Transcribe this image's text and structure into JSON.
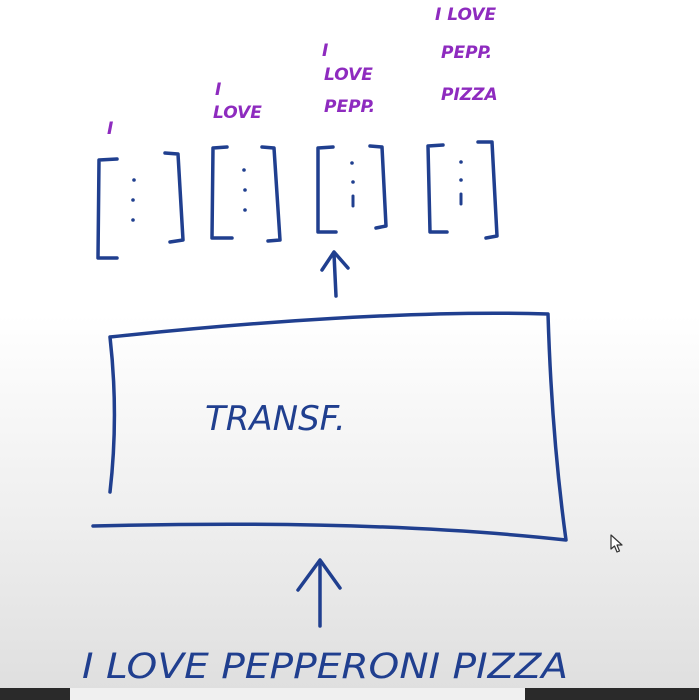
{
  "diagram": {
    "outputs": [
      {
        "lines": [
          "I"
        ]
      },
      {
        "lines": [
          "I",
          "LOVE"
        ]
      },
      {
        "lines": [
          "I",
          "LOVE",
          "PEPP."
        ]
      },
      {
        "lines": [
          "I LOVE",
          "PEPP.",
          "PIZZA"
        ]
      }
    ],
    "box_label": "TRANSF.",
    "input_text": "I LOVE PEPPERONI PIZZA",
    "colors": {
      "label": "#8e2bbf",
      "ink": "#203f8f"
    }
  }
}
